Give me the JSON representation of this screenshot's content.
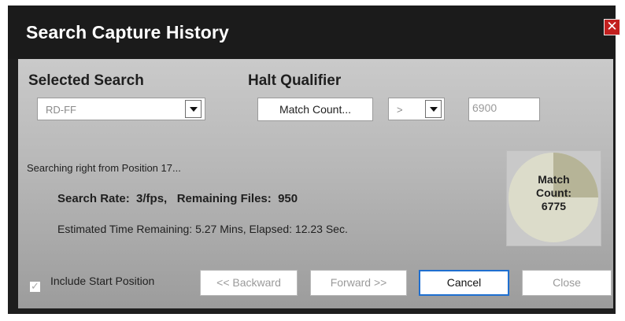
{
  "window": {
    "title": "Search Capture History",
    "close_glyph": "✕"
  },
  "selected_search": {
    "heading": "Selected Search",
    "value": "RD-FF",
    "arrow_icon": "chevron-down-icon"
  },
  "halt_qualifier": {
    "heading": "Halt Qualifier",
    "field": "Match Count...",
    "operator": ">",
    "value": "6900"
  },
  "status": {
    "message": "Searching right from Position 17...",
    "rate_line": "Search Rate:  3/fps,   Remaining Files:  950",
    "estimate_line": "Estimated Time Remaining: 5.27 Mins, Elapsed: 12.23 Sec."
  },
  "progress": {
    "label_line1": "Match",
    "label_line2": "Count:",
    "label_line3": "6775",
    "match_count": 6775,
    "halt_value": 6900,
    "fraction_shown": 0.25,
    "colors": {
      "slice": "#b6b497",
      "rest": "#dcdcca",
      "bg": "#c9c9c9"
    }
  },
  "options": {
    "include_start_label": "Include Start Position",
    "include_start_checked": true,
    "check_glyph": "✓"
  },
  "buttons": {
    "backward": "<< Backward",
    "forward": "Forward >>",
    "cancel": "Cancel",
    "close": "Close"
  }
}
